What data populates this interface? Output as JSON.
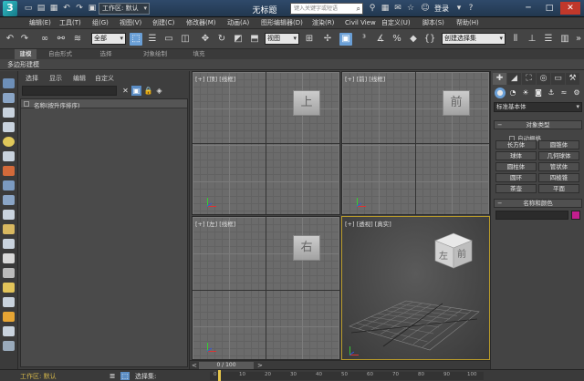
{
  "titlebar": {
    "workspace_label": "工作区: 默认",
    "window_title": "无标题",
    "search_placeholder": "键入关键字或短语",
    "login": "登录",
    "minimize": "─",
    "maximize": "□",
    "close": "✕"
  },
  "menu": {
    "items": [
      "编辑(E)",
      "工具(T)",
      "组(G)",
      "视图(V)",
      "创建(C)",
      "修改器(M)",
      "动画(A)",
      "图形编辑器(D)",
      "渲染(R)",
      "Civil View",
      "自定义(U)",
      "脚本(S)",
      "帮助(H)"
    ]
  },
  "toolbar": {
    "selection_filter": "全部",
    "ref_coord": "视图",
    "named_selection": "创建选择集"
  },
  "ribbon": {
    "tabs": [
      "建模",
      "自由形式",
      "选择",
      "对象绘制",
      "填充"
    ],
    "sub_label": "多边形建模"
  },
  "scene_explorer": {
    "menu": [
      "选择",
      "显示",
      "编辑",
      "自定义"
    ],
    "column_header": "名称(按升序排序)"
  },
  "viewports": {
    "top": {
      "label": "[+] [顶] [线框]",
      "cube": "上"
    },
    "front": {
      "label": "[+] [前] [线框]",
      "cube": "前"
    },
    "left": {
      "label": "[+] [左] [线框]",
      "cube": "右"
    },
    "persp": {
      "label": "[+] [透视] [真实]",
      "cube_top": "左",
      "cube_front": "前"
    }
  },
  "command_panel": {
    "category": "标准基本体",
    "object_type_header": "对象类型",
    "autogrid": "自动栅格",
    "buttons": [
      "长方体",
      "圆锥体",
      "球体",
      "几何球体",
      "圆柱体",
      "管状体",
      "圆环",
      "四棱锥",
      "茶壶",
      "平面"
    ],
    "name_color_header": "名称和颜色",
    "swatch_color": "#c41e8e"
  },
  "timeline": {
    "frame": "0 / 100"
  },
  "statusbar": {
    "workspace": "工作区: 默认",
    "selection_set": "选择集:",
    "ruler_ticks": [
      "0",
      "10",
      "20",
      "30",
      "40",
      "50",
      "60",
      "70",
      "80",
      "90",
      "100"
    ]
  }
}
